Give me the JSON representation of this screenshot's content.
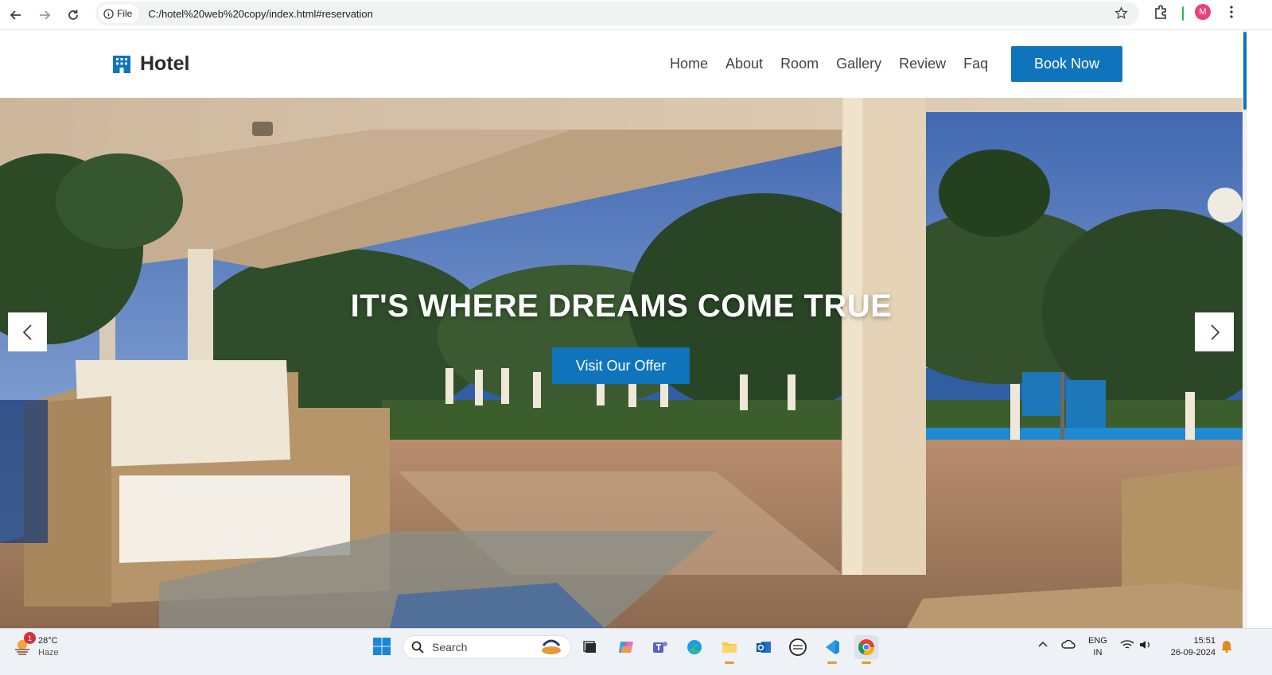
{
  "browser": {
    "site_chip_label": "File",
    "url": "C:/hotel%20web%20copy/index.html#reservation",
    "profile_initial": "M"
  },
  "site": {
    "brand_name": "Hotel",
    "brand_icon": "hotel-building-icon",
    "nav": [
      "Home",
      "About",
      "Room",
      "Gallery",
      "Review",
      "Faq"
    ],
    "book_now_label": "Book Now",
    "accent_color": "#0f74bb"
  },
  "hero": {
    "title": "IT'S WHERE DREAMS COME TRUE",
    "cta_label": "Visit Our Offer",
    "prev_icon": "chevron-left-icon",
    "next_icon": "chevron-right-icon"
  },
  "taskbar": {
    "weather_temp": "28°C",
    "weather_desc": "Haze",
    "weather_badge": "1",
    "search_placeholder": "Search",
    "lang_line1": "ENG",
    "lang_line2": "IN",
    "time": "15:51",
    "date": "26-09-2024"
  }
}
